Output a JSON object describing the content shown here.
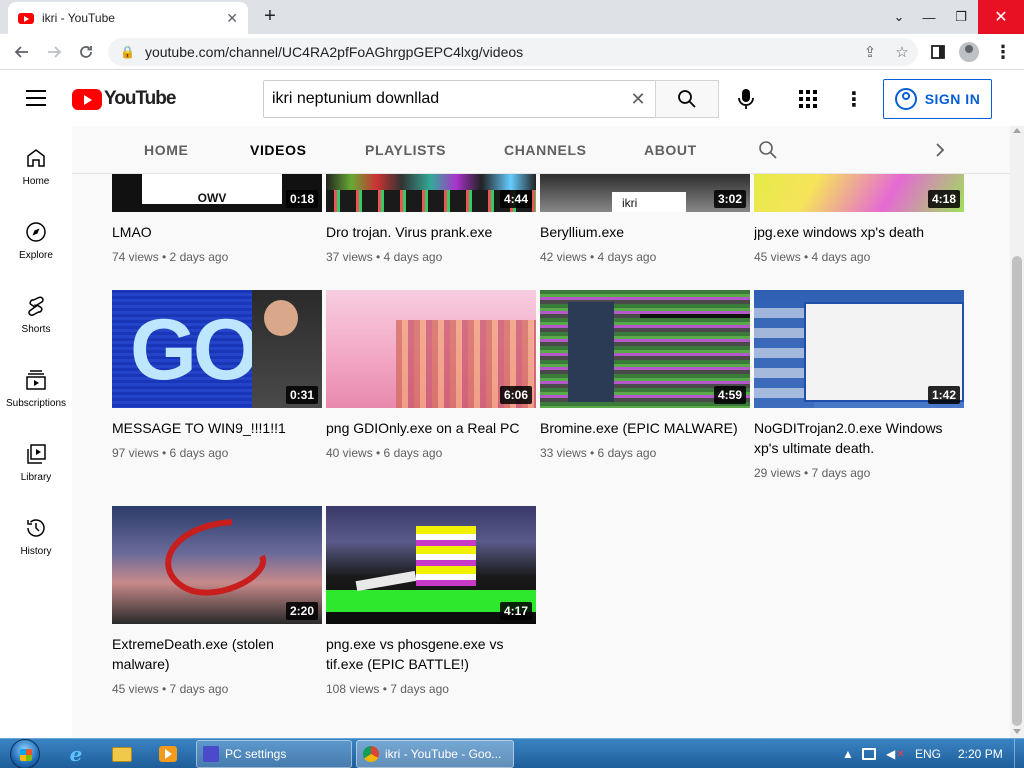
{
  "browser": {
    "tab_title": "ikri - YouTube",
    "url": "youtube.com/channel/UC4RA2pfFoAGhrgpGEPC4lxg/videos"
  },
  "masthead": {
    "logo_text": "YouTube",
    "search_query": "ikri neptunium downllad",
    "signin_label": "SIGN IN"
  },
  "guide": {
    "items": [
      {
        "label": "Home",
        "icon": "home-icon"
      },
      {
        "label": "Explore",
        "icon": "compass-icon"
      },
      {
        "label": "Shorts",
        "icon": "shorts-icon"
      },
      {
        "label": "Subscriptions",
        "icon": "subscriptions-icon"
      },
      {
        "label": "Library",
        "icon": "library-icon"
      },
      {
        "label": "History",
        "icon": "history-icon"
      }
    ]
  },
  "channel_tabs": [
    "HOME",
    "VIDEOS",
    "PLAYLISTS",
    "CHANNELS",
    "ABOUT"
  ],
  "active_tab": "VIDEOS",
  "videos": [
    {
      "title": "LMAO",
      "duration": "0:18",
      "meta": "74 views • 2 days ago"
    },
    {
      "title": "Dro trojan. Virus prank.exe",
      "duration": "4:44",
      "meta": "37 views • 4 days ago"
    },
    {
      "title": "Beryllium.exe",
      "duration": "3:02",
      "meta": "42 views • 4 days ago"
    },
    {
      "title": "jpg.exe windows xp's death",
      "duration": "4:18",
      "meta": "45 views • 4 days ago"
    },
    {
      "title": "MESSAGE TO WIN9_!!!1!!1",
      "duration": "0:31",
      "meta": "97 views • 6 days ago"
    },
    {
      "title": "png GDIOnly.exe on a Real PC",
      "duration": "6:06",
      "meta": "40 views • 6 days ago"
    },
    {
      "title": "Bromine.exe (EPIC MALWARE)",
      "duration": "4:59",
      "meta": "33 views • 6 days ago"
    },
    {
      "title": "NoGDITrojan2.0.exe Windows xp's ultimate death.",
      "duration": "1:42",
      "meta": "29 views • 7 days ago"
    },
    {
      "title": "ExtremeDeath.exe (stolen malware)",
      "duration": "2:20",
      "meta": "45 views • 7 days ago"
    },
    {
      "title": "png.exe vs phosgene.exe vs tif.exe (EPIC BATTLE!)",
      "duration": "4:17",
      "meta": "108 views • 7 days ago"
    }
  ],
  "thumb_text": {
    "v0": "OWV",
    "v2": "ikri",
    "v4": "GOT"
  },
  "taskbar": {
    "windows": [
      {
        "label": "PC settings"
      },
      {
        "label": "ikri - YouTube - Goo..."
      }
    ],
    "language": "ENG",
    "time": "2:20 PM"
  },
  "colors": {
    "youtube_red": "#ff0000",
    "link_blue": "#065fd4",
    "taskbar": "#1e5d9a"
  }
}
